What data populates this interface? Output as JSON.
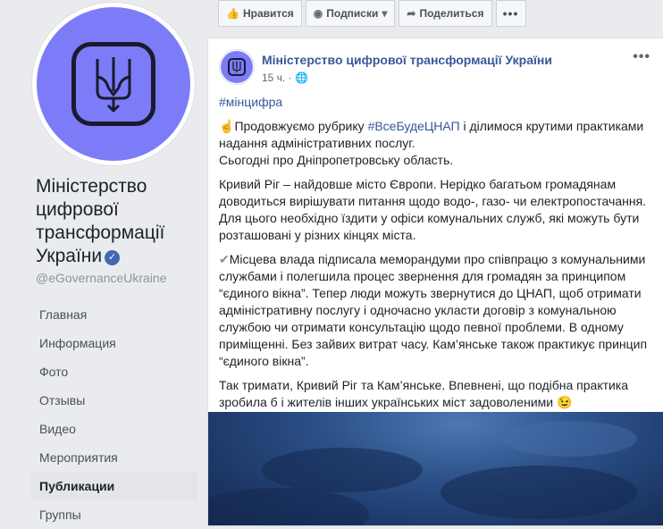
{
  "sidebar": {
    "page_name": "Міністерство цифрової трансформації України",
    "verified_icon": "verified-check-icon",
    "handle": "@eGovernanceUkraine",
    "nav": [
      {
        "label": "Главная",
        "active": false
      },
      {
        "label": "Информация",
        "active": false
      },
      {
        "label": "Фото",
        "active": false
      },
      {
        "label": "Отзывы",
        "active": false
      },
      {
        "label": "Видео",
        "active": false
      },
      {
        "label": "Мероприятия",
        "active": false
      },
      {
        "label": "Публикации",
        "active": true
      },
      {
        "label": "Группы",
        "active": false
      }
    ]
  },
  "actions": {
    "like_label": "Нравится",
    "follow_label": "Подписки",
    "share_label": "Поделиться",
    "more_label": "•••"
  },
  "post": {
    "author": "Міністерство цифрової трансформації України",
    "time": "15 ч.",
    "privacy_icon": "globe-icon",
    "more_label": "•••",
    "hashtag": "#мінцифра",
    "p1_emoji": "☝",
    "p1_a": "Продовжуємо рубрику ",
    "p1_tag": "#ВсеБудеЦНАП",
    "p1_b": " і ділимося крутими практиками надання адміністративних послуг.",
    "p1_c": "Сьогодні про Дніпропетровську область.",
    "p2": "Кривий Ріг – найдовше місто Європи. Нерідко багатьом громадянам доводиться вирішувати питання щодо водо-, газо- чи електропостачання. Для цього необхідно їздити у офіси комунальних служб, які можуть бути розташовані у різних кінцях міста.",
    "p3_emoji": "✔",
    "p3": "Місцева влада підписала меморандуми про співпрацю з комунальними службами і полегшила процес звернення для громадян за принципом “єдиного вікна”. Тепер люди можуть звернутися до ЦНАП, щоб отримати адміністративну послугу і одночасно укласти договір з комунальною службою чи отримати консультацію щодо певної проблеми. В одному приміщенні. Без зайвих витрат часу. Кам’янське також практикує принцип “єдиного вікна”.",
    "p4": "Так тримати, Кривий Ріг та Кам’янське. Впевнені, що подібна практика зробила б і жителів інших українських міст задоволеними",
    "p4_emoji": "😉"
  },
  "colors": {
    "brand_purple": "#7c7cf8",
    "link": "#385898",
    "fb_blue": "#4267b2"
  }
}
